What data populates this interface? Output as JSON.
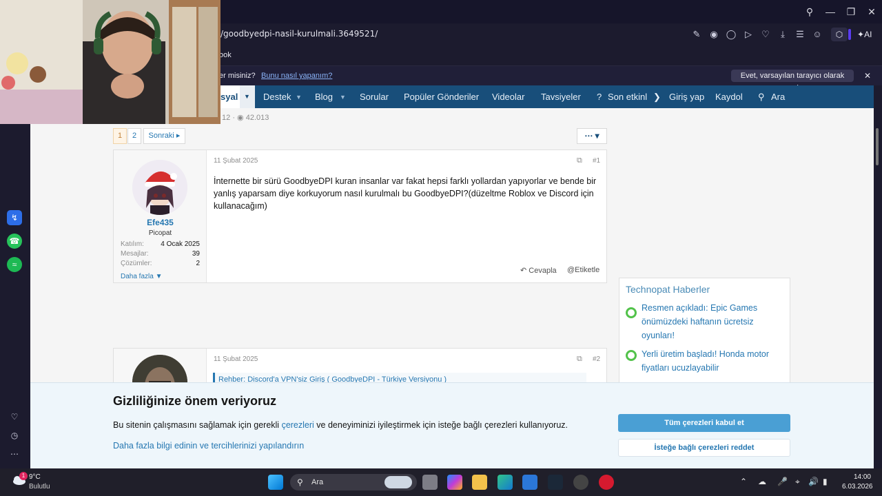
{
  "browser": {
    "url": "/goodbyedpi-nasil-kurulmali.3649521/",
    "bookmark_label": "ook",
    "ai_label": "AI",
    "default_prompt": {
      "question": "er misiniz?",
      "link": "Bunu nasıl yapanım?",
      "button": "Evet, varsayılan tarayıcı olarak ayarla"
    }
  },
  "nav": {
    "active": "syal",
    "items": [
      "Destek",
      "Blog",
      "Sorular",
      "Popüler Gönderiler",
      "Videolar",
      "Tavsiyeler",
      "Son etkinl"
    ],
    "login": "Giriş yap",
    "register": "Kaydol",
    "search": "Ara"
  },
  "thread": {
    "meta_replies": "12",
    "meta_views": "42.013",
    "pages": [
      "1",
      "2"
    ],
    "next": "Sonraki"
  },
  "post1": {
    "date": "11 Şubat 2025",
    "number": "#1",
    "user": "Efe435",
    "user_title": "Picopat",
    "stats": [
      {
        "label": "Katılım:",
        "value": "4 Ocak 2025"
      },
      {
        "label": "Mesajlar:",
        "value": "39"
      },
      {
        "label": "Çözümler:",
        "value": "2"
      }
    ],
    "more": "Daha fazla",
    "body": "İnternette bir sürü GoodbyeDPI kuran insanlar var fakat hepsi farklı yollardan yapıyorlar ve bende bir yanlış yaparsam diye korkuyorum nasıl kurulmalı bu GoodbyeDPI?(düzeltme Roblox ve Discord için kullanacağım)",
    "reply": "Cevapla",
    "tag": "Etiketle"
  },
  "post2": {
    "date": "11 Şubat 2025",
    "number": "#2",
    "quote": "Rehber: Discord'a VPN'siz Giriş ( GoodbyeDPI - Türkiye Versiyonu )"
  },
  "news": {
    "title": "Technopat Haberler",
    "items": [
      "Resmen açıkladı: Epic Games önümüzdeki haftanın ücretsiz oyunları!",
      "Yerli üretim başladı! Honda motor fiyatları ucuzlayabilir"
    ]
  },
  "cookie": {
    "title": "Gizliliğinize önem veriyoruz",
    "text_before": "Bu sitenin çalışmasını sağlamak için gerekli ",
    "text_link": "çerezleri",
    "text_after": " ve deneyiminizi iyileştirmek için isteğe bağlı çerezleri kullanıyoruz.",
    "more": "Daha fazla bilgi edinin ve tercihlerinizi yapılandırın",
    "accept": "Tüm çerezleri kabul et",
    "reject": "İsteğe bağlı çerezleri reddet"
  },
  "taskbar": {
    "temp": "9°C",
    "condition": "Bulutlu",
    "weather_badge": "1",
    "search": "Ara",
    "time": "14:00",
    "date": "6.03.2026"
  },
  "colors": {
    "nav_bg": "#184e7a",
    "link": "#2577b1",
    "accept_btn": "#4a9fd4",
    "chrome_bg": "#1c1b2e"
  }
}
